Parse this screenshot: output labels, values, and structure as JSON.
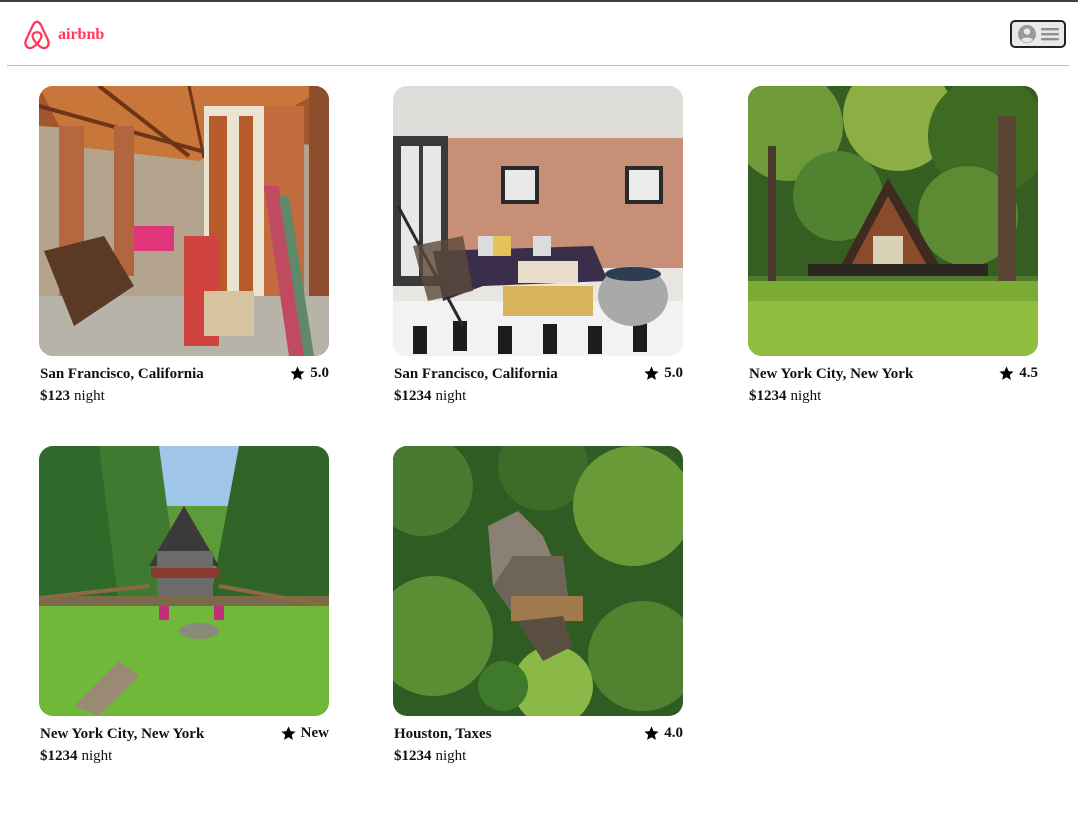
{
  "header": {
    "brand": "airbnb",
    "logo_icon": "airbnb-logo-icon",
    "menu_icons": [
      "user-avatar-icon",
      "hamburger-menu-icon"
    ],
    "brand_color": "#ff385c"
  },
  "listings": [
    {
      "location": "San Francisco, California",
      "rating": "5.0",
      "price": "$123",
      "unit": "night",
      "photo": "cabin-interior-sunroom-photo"
    },
    {
      "location": "San Francisco, California",
      "rating": "5.0",
      "price": "$1234",
      "unit": "night",
      "photo": "loft-living-room-photo"
    },
    {
      "location": "New York City, New York",
      "rating": "4.5",
      "price": "$1234",
      "unit": "night",
      "photo": "a-frame-cabin-forest-photo"
    },
    {
      "location": "New York City, New York",
      "rating": "New",
      "price": "$1234",
      "unit": "night",
      "photo": "a-frame-cabin-yard-photo"
    },
    {
      "location": "Houston, Taxes",
      "rating": "4.0",
      "price": "$1234",
      "unit": "night",
      "photo": "cabin-aerial-forest-photo"
    }
  ]
}
